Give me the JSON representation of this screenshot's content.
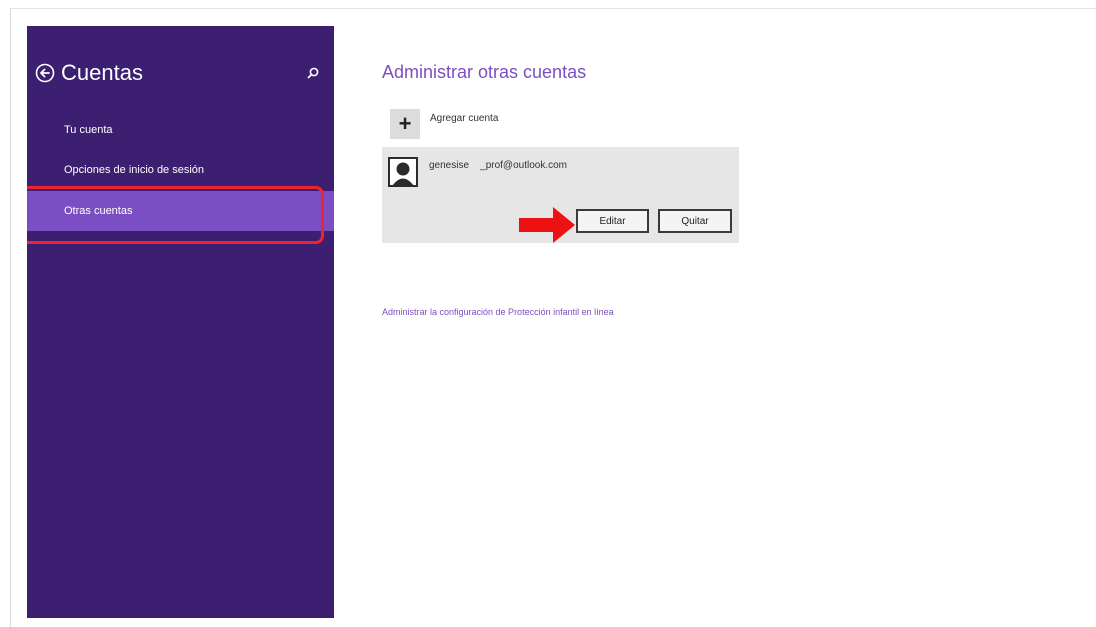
{
  "sidebar": {
    "title": "Cuentas",
    "back_icon": "back-arrow-circle-icon",
    "search_icon": "search-icon",
    "items": [
      {
        "label": "Tu cuenta",
        "selected": false
      },
      {
        "label": "Opciones de inicio de sesión",
        "selected": false
      },
      {
        "label": "Otras cuentas",
        "selected": true
      }
    ],
    "background_color": "#3c1f70",
    "selected_color": "#7b4fc3"
  },
  "main": {
    "title": "Administrar otras cuentas",
    "add_account": {
      "icon": "plus-icon",
      "label": "Agregar cuenta"
    },
    "account": {
      "avatar_icon": "user-avatar-icon",
      "name_email": "genesise    _prof@outlook.com",
      "edit_label": "Editar",
      "remove_label": "Quitar"
    },
    "family_link": "Administrar la configuración de Protección infantil en línea",
    "accent_color": "#7b4fc3"
  },
  "annotations": {
    "highlight_color": "#ee2233",
    "arrow_icon": "red-arrow-icon"
  }
}
